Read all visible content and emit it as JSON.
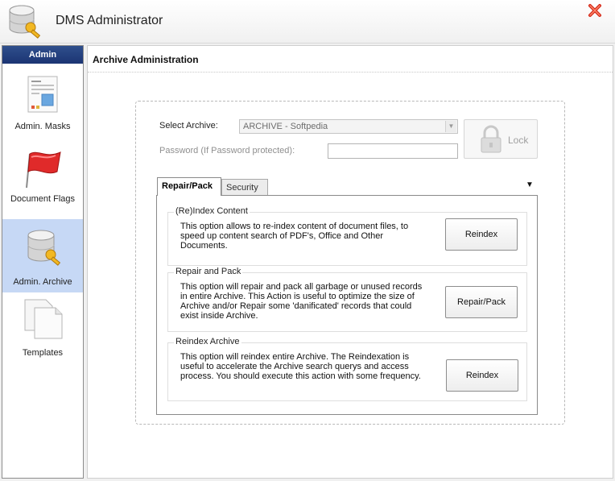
{
  "window": {
    "title": "DMS Administrator",
    "app_icon": "database-key-icon",
    "close_icon": "close-x-icon"
  },
  "sidebar": {
    "header": "Admin",
    "items": [
      {
        "label": "Admin. Masks",
        "icon": "document-layout-icon",
        "active": false
      },
      {
        "label": "Document Flags",
        "icon": "red-flag-icon",
        "active": false
      },
      {
        "label": "Admin. Archive",
        "icon": "database-key-icon",
        "active": true
      },
      {
        "label": "Templates",
        "icon": "blank-pages-icon",
        "active": false
      }
    ]
  },
  "main": {
    "title": "Archive Administration",
    "select_archive_label": "Select Archive:",
    "archive_value": "ARCHIVE - Softpedia",
    "password_label": "Password (If Password protected):",
    "password_value": "",
    "lock_label": "Lock",
    "tabs": [
      {
        "label": "Repair/Pack",
        "active": true
      },
      {
        "label": "Security",
        "active": false
      }
    ],
    "groups": [
      {
        "title": "(Re)Index Content",
        "description": "This option allows to re-index content of document files, to speed up content search of PDF's, Office and Other Documents.",
        "button": "Reindex"
      },
      {
        "title": "Repair and Pack",
        "description": "This option will repair and pack all garbage or unused records in entire Archive. This Action is useful to optimize the size of Archive and/or Repair some 'danificated' records that could exist inside Archive.",
        "button": "Repair/Pack"
      },
      {
        "title": "Reindex Archive",
        "description": "This option will reindex entire Archive. The Reindexation is useful to accelerate the Archive search querys and access process. You should execute this action with some frequency.",
        "button": "Reindex"
      }
    ]
  },
  "colors": {
    "sidebar_header": "#1f3a7a",
    "active_item": "#c6d8f5",
    "close_red": "#d42a1a"
  }
}
